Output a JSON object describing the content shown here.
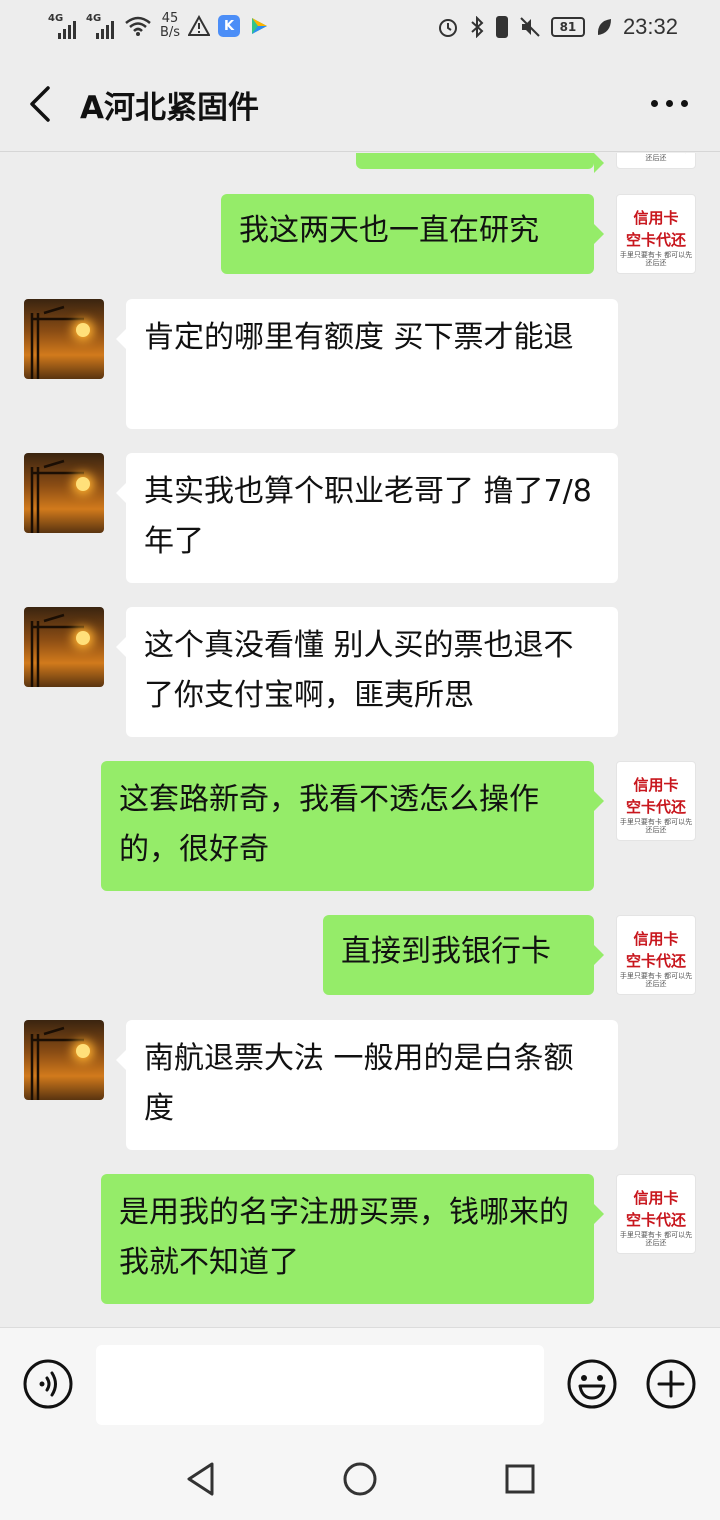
{
  "status_bar": {
    "net1": "4G",
    "net2": "4G",
    "speed_value": "45",
    "speed_unit": "B/s",
    "app_k": "K",
    "battery": "81",
    "time": "23:32"
  },
  "header": {
    "title": "A河北紧固件"
  },
  "avatar_card": {
    "line1": "信用卡",
    "line2": "空卡代还",
    "line3": "手里只要有卡 都可以先还后还"
  },
  "messages": [
    {
      "side": "out",
      "text": "我这两天也一直在研究"
    },
    {
      "side": "in",
      "text": "肯定的哪里有额度  买下票才能退"
    },
    {
      "side": "in",
      "text": "其实我也算个职业老哥了  撸了7/8 年了"
    },
    {
      "side": "in",
      "text": "这个真没看懂  别人买的票也退不了你支付宝啊，匪夷所思"
    },
    {
      "side": "out",
      "text": "这套路新奇，我看不透怎么操作的，很好奇"
    },
    {
      "side": "out",
      "text": "直接到我银行卡"
    },
    {
      "side": "in",
      "text": "南航退票大法 一般用的是白条额度"
    },
    {
      "side": "out",
      "text": "是用我的名字注册买票，钱哪来的我就不知道了"
    }
  ],
  "colors": {
    "background": "#ededed",
    "out_bubble": "#95ec69",
    "in_bubble": "#ffffff",
    "card_red": "#c8161d"
  },
  "icons": [
    "back-arrow-icon",
    "more-icon",
    "voice-icon",
    "emoji-icon",
    "plus-icon",
    "nav-back-icon",
    "nav-home-icon",
    "nav-recent-icon"
  ]
}
